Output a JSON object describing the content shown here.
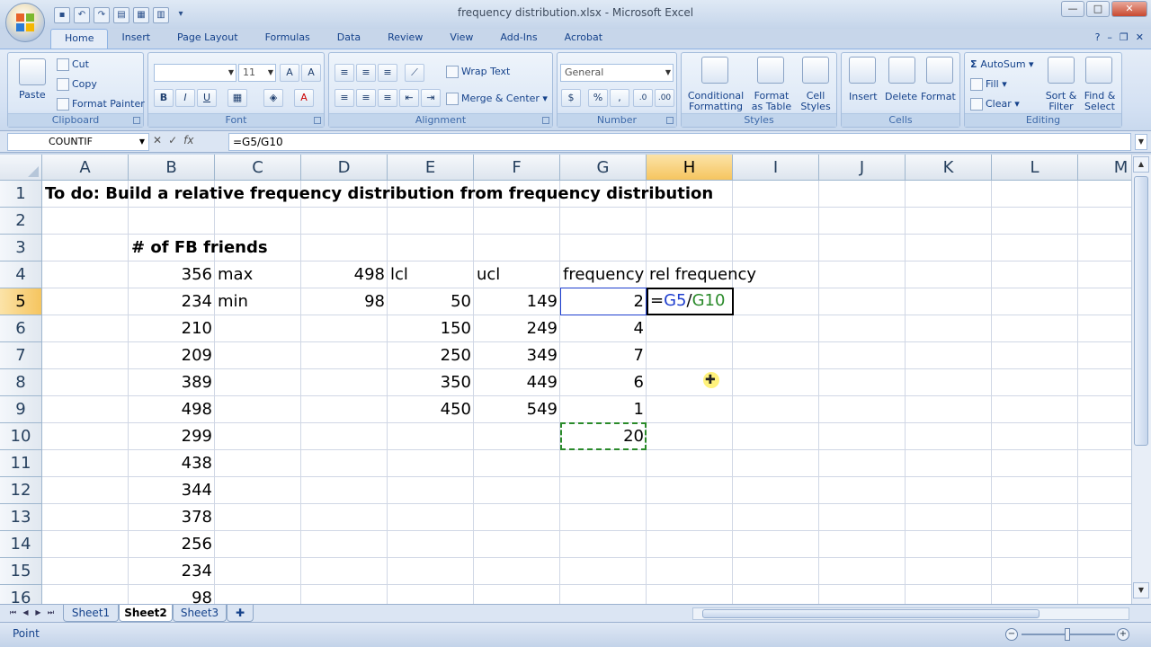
{
  "window": {
    "title": "frequency distribution.xlsx - Microsoft Excel"
  },
  "ribbon_tabs": [
    "Home",
    "Insert",
    "Page Layout",
    "Formulas",
    "Data",
    "Review",
    "View",
    "Add-Ins",
    "Acrobat"
  ],
  "groups": {
    "clipboard": {
      "label": "Clipboard",
      "paste": "Paste",
      "cut": "Cut",
      "copy": "Copy",
      "format_painter": "Format Painter"
    },
    "font": {
      "label": "Font",
      "font_name": "",
      "font_size": "11"
    },
    "alignment": {
      "label": "Alignment",
      "wrap_text": "Wrap Text",
      "merge_center": "Merge & Center"
    },
    "number": {
      "label": "Number",
      "format": "General",
      "currency": "$",
      "percent": "%"
    },
    "styles": {
      "label": "Styles",
      "conditional_line1": "Conditional",
      "conditional_line2": "Formatting",
      "format_table_line1": "Format",
      "format_table_line2": "as Table",
      "cell_styles_line1": "Cell",
      "cell_styles_line2": "Styles"
    },
    "cells": {
      "label": "Cells",
      "insert": "Insert",
      "delete": "Delete",
      "format": "Format"
    },
    "editing": {
      "label": "Editing",
      "autosum": "AutoSum",
      "fill": "Fill",
      "clear": "Clear",
      "sort_line1": "Sort &",
      "sort_line2": "Filter",
      "find_line1": "Find &",
      "find_line2": "Select"
    }
  },
  "formula_bar": {
    "name_box": "COUNTIF",
    "formula": "=G5/G10"
  },
  "columns": [
    "A",
    "B",
    "C",
    "D",
    "E",
    "F",
    "G",
    "H",
    "I",
    "J",
    "K",
    "L",
    "M"
  ],
  "rows": [
    "1",
    "2",
    "3",
    "4",
    "5",
    "6",
    "7",
    "8",
    "9",
    "10",
    "11",
    "12",
    "13",
    "14",
    "15",
    "16"
  ],
  "cells": {
    "A1": "To do:  Build a relative frequency distribution from frequency distribution",
    "B3": "# of FB friends",
    "B4": "356",
    "C4": "max",
    "D4": "498",
    "E4": "lcl",
    "F4": "ucl",
    "G4": "frequency",
    "H4": "rel frequency",
    "B5": "234",
    "C5": "min",
    "D5": "98",
    "E5": "50",
    "F5": "149",
    "G5": "2",
    "B6": "210",
    "E6": "150",
    "F6": "249",
    "G6": "4",
    "B7": "209",
    "E7": "250",
    "F7": "349",
    "G7": "7",
    "B8": "389",
    "E8": "350",
    "F8": "449",
    "G8": "6",
    "B9": "498",
    "E9": "450",
    "F9": "549",
    "G9": "1",
    "B10": "299",
    "G10": "20",
    "B11": "438",
    "B12": "344",
    "B13": "378",
    "B14": "256",
    "B15": "234",
    "B16": "98"
  },
  "edit_cell": {
    "eq": "=",
    "ref1": "G5",
    "op": "/",
    "ref2": "G10",
    "ref1_color": "#1f3fcf",
    "ref2_color": "#2a8a2a"
  },
  "sheets": [
    "Sheet1",
    "Sheet2",
    "Sheet3"
  ],
  "active_sheet": "Sheet2",
  "status": {
    "mode": "Point"
  },
  "accent_colors": {
    "selected_header": "#f6c55f",
    "ribbon": "#dbe5f3"
  }
}
